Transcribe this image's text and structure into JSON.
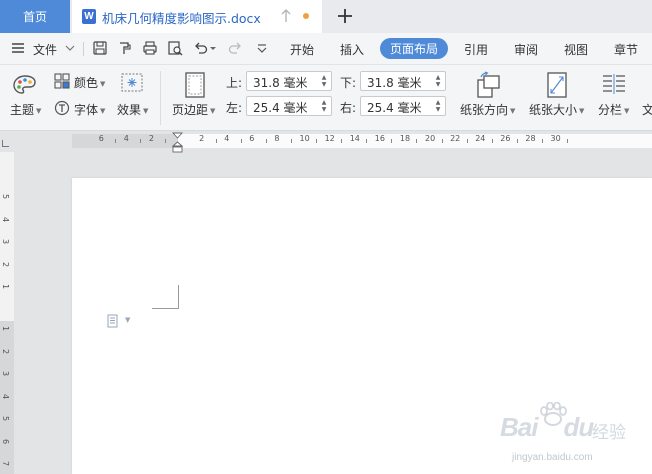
{
  "tabs": {
    "home_label": "首页",
    "doc_icon_letter": "W",
    "doc_title": "机床几何精度影响图示.docx"
  },
  "menubar": {
    "file_label": "文件",
    "tabs": [
      "开始",
      "插入",
      "页面布局",
      "引用",
      "审阅",
      "视图",
      "章节"
    ],
    "active_tab": "页面布局"
  },
  "ribbon": {
    "theme_label": "主题",
    "color_label": "颜色",
    "font_label": "字体",
    "effect_label": "效果",
    "margins_label": "页边距",
    "top_label": "上:",
    "top_value": "31.8 毫米",
    "bottom_label": "下:",
    "bottom_value": "31.8 毫米",
    "left_label": "左:",
    "left_value": "25.4 毫米",
    "right_label": "右:",
    "right_value": "25.4 毫米",
    "orientation_label": "纸张方向",
    "size_label": "纸张大小",
    "columns_label": "分栏",
    "cutoff_label": "文"
  },
  "ruler": {
    "labels": [
      "6",
      "4",
      "2",
      "2",
      "4",
      "6",
      "8",
      "10",
      "12",
      "14",
      "16",
      "18",
      "20",
      "22",
      "24",
      "26",
      "28",
      "30"
    ]
  },
  "vruler": {
    "labels": [
      "5",
      "4",
      "3",
      "2",
      "1",
      "1",
      "2",
      "3",
      "4",
      "5",
      "6",
      "7"
    ]
  },
  "watermark": {
    "main": "Bai",
    "du": "du",
    "sub": "经验",
    "url": "jingyan.baidu.com"
  }
}
